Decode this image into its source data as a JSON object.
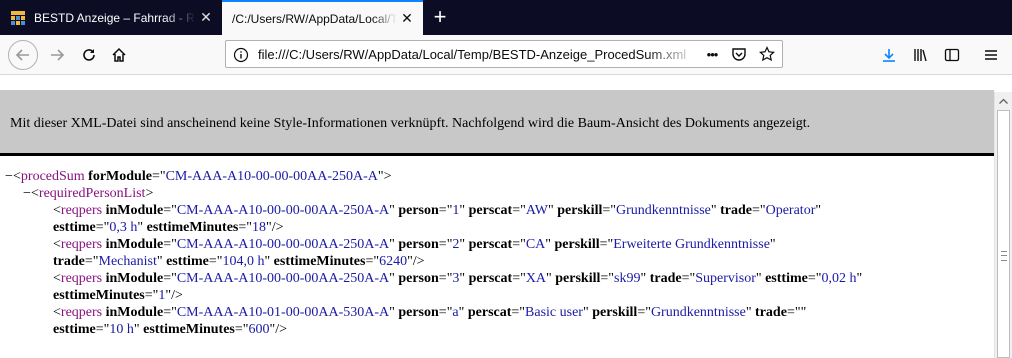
{
  "tabs": [
    {
      "title": "BESTD Anzeige – Fahrrad - Reimportiert",
      "close": "✕"
    },
    {
      "title": "/C:/Users/RW/AppData/Local/Temp/BESTD-Anzeige_ProcedSum.xml",
      "close": "✕"
    }
  ],
  "newtab_label": "+",
  "nav": {
    "url": "file:///C:/Users/RW/AppData/Local/Temp/BESTD-Anzeige_ProcedSum.xml",
    "page_actions_label": "•••"
  },
  "notice": "Mit dieser XML-Datei sind anscheinend keine Style-Informationen verknüpft. Nachfolgend wird die Baum-Ansicht des Dokuments angezeigt.",
  "xml": {
    "toggle": "−",
    "root_tag": "procedSum",
    "root_attr": "forModule",
    "root_val": "CM-AAA-A10-00-00-00AA-250A-A",
    "list_tag": "requiredPersonList",
    "child_tag": "reqpers",
    "attr_names": {
      "inModule": "inModule",
      "person": "person",
      "perscat": "perscat",
      "perskill": "perskill",
      "trade": "trade",
      "esttime": "esttime",
      "esttimeMinutes": "esttimeMinutes"
    },
    "rows": [
      {
        "inModule": "CM-AAA-A10-00-00-00AA-250A-A",
        "person": "1",
        "perscat": "AW",
        "perskill": "Grundkenntnisse",
        "trade": "Operator",
        "esttime": "0,3 h",
        "esttimeMinutes": "18"
      },
      {
        "inModule": "CM-AAA-A10-00-00-00AA-250A-A",
        "person": "2",
        "perscat": "CA",
        "perskill": "Erweiterte Grundkenntnisse",
        "trade": "Mechanist",
        "esttime": "104,0 h",
        "esttimeMinutes": "6240"
      },
      {
        "inModule": "CM-AAA-A10-00-00-00AA-250A-A",
        "person": "3",
        "perscat": "XA",
        "perskill": "sk99",
        "trade": "Supervisor",
        "esttime": "0,02 h",
        "esttimeMinutes": "1"
      },
      {
        "inModule": "CM-AAA-A10-01-00-00AA-530A-A",
        "person": "a",
        "perscat": "Basic user",
        "perskill": "Grundkenntnisse",
        "trade": "",
        "esttime": "10 h",
        "esttimeMinutes": "600"
      }
    ]
  },
  "colors": {
    "tag": "#881280",
    "value": "#1a1aa6",
    "accent": "#0a84ff",
    "tabstrip": "#0c0c25"
  }
}
